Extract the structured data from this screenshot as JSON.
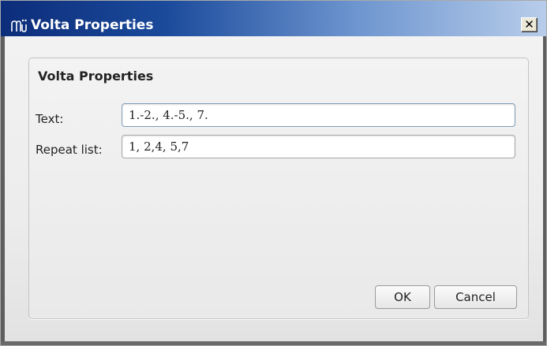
{
  "window": {
    "title": "Volta Properties",
    "app_icon": "musescore-icon",
    "close_symbol": "✕"
  },
  "group": {
    "title": "Volta Properties"
  },
  "fields": {
    "text_label": "Text:",
    "text_value": "1.-2., 4.-5., 7.",
    "repeat_label": "Repeat list:",
    "repeat_value": "1, 2,4, 5,7"
  },
  "buttons": {
    "ok": "OK",
    "cancel": "Cancel"
  }
}
